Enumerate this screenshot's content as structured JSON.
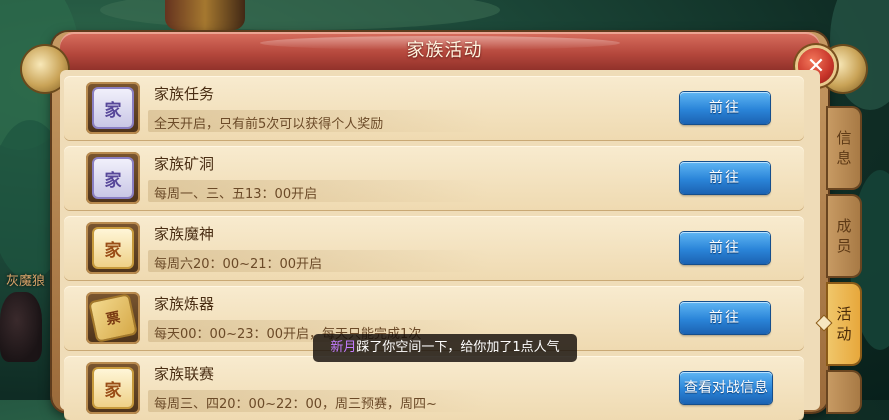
{
  "window": {
    "title": "家族活动",
    "close_label": "✕"
  },
  "background": {
    "monster_name": "灰魔狼"
  },
  "activities": [
    {
      "title": "家族任务",
      "desc": "全天开启，只有前5次可以获得个人奖励",
      "icon": "家",
      "icon_style": "purple",
      "button": "前往"
    },
    {
      "title": "家族矿洞",
      "desc": "每周一、三、五13：00开启",
      "icon": "家",
      "icon_style": "purple",
      "button": "前往"
    },
    {
      "title": "家族魔神",
      "desc": "每周六20：00~21：00开启",
      "icon": "家",
      "icon_style": "gold",
      "button": "前往"
    },
    {
      "title": "家族炼器",
      "desc": "每天00：00~23：00开启，每天只能完成1次",
      "icon": "票",
      "icon_style": "ticket",
      "button": "前往"
    },
    {
      "title": "家族联赛",
      "desc": "每周三、四20：00~22：00，周三预赛，周四~",
      "icon": "家",
      "icon_style": "gold",
      "button": "查看对战信息"
    }
  ],
  "side_tabs": [
    {
      "label_1": "信",
      "label_2": "息",
      "active": false
    },
    {
      "label_1": "成",
      "label_2": "员",
      "active": false
    },
    {
      "label_1": "活",
      "label_2": "动",
      "active": true
    }
  ],
  "toast": {
    "name": "新月",
    "message": "踩了你空间一下，给你加了1点人气"
  },
  "colors": {
    "button_blue": "#2a84d8",
    "title_red": "#b4473c",
    "active_tab": "#e7a83c",
    "toast_name": "#c37cff"
  }
}
